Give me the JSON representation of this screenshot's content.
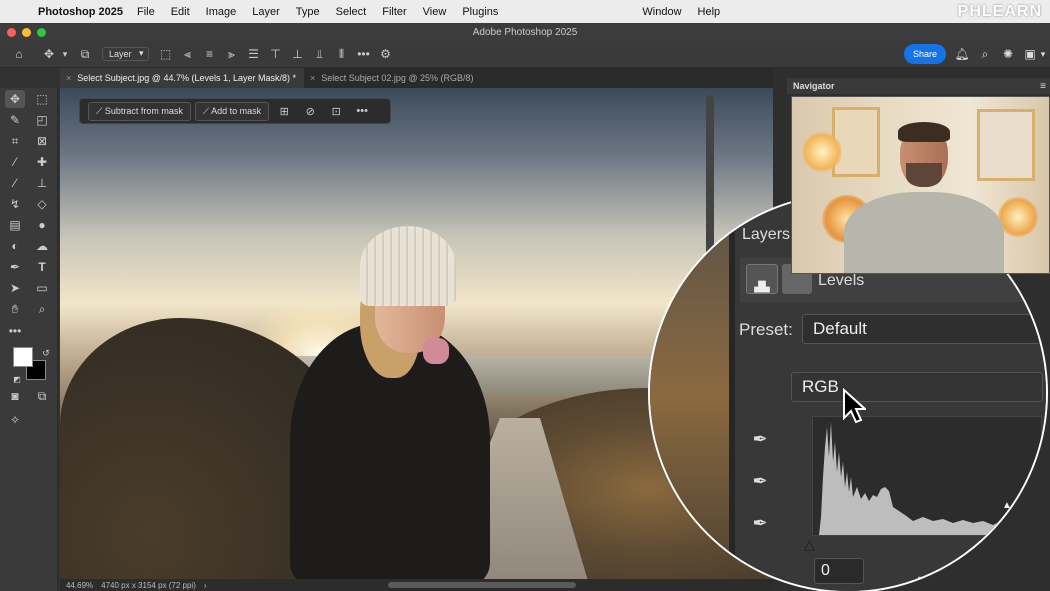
{
  "menubar": {
    "app_name": "Photoshop 2025",
    "items": [
      "File",
      "Edit",
      "Image",
      "Layer",
      "Type",
      "Select",
      "Filter",
      "View",
      "Plugins",
      "Window",
      "Help"
    ],
    "brand": "PHLEARN"
  },
  "window": {
    "title": "Adobe Photoshop 2025"
  },
  "options_bar": {
    "layer_select": "Layer",
    "share_label": "Share"
  },
  "tabs": [
    {
      "label": "Select Subject.jpg @ 44.7% (Levels 1, Layer Mask/8) *",
      "active": true
    },
    {
      "label": "Select Subject 02.jpg @ 25% (RGB/8)",
      "active": false
    }
  ],
  "mask_toolbar": {
    "subtract_label": "Subtract from mask",
    "add_label": "Add to mask"
  },
  "status": {
    "zoom": "44.69%",
    "doc_info": "4740 px x 3154 px (72 ppi)",
    "arrow": "›"
  },
  "navigator": {
    "title": "Navigator"
  },
  "properties": {
    "layers_title": "Layers",
    "adjustment_label": "Levels",
    "preset_label": "Preset:",
    "preset_value": "Default",
    "channel_value": "RGB",
    "input_black": "0"
  },
  "colors": {
    "accent": "#1473e6",
    "panel": "#383838",
    "toolbar": "#3a3a3a"
  }
}
